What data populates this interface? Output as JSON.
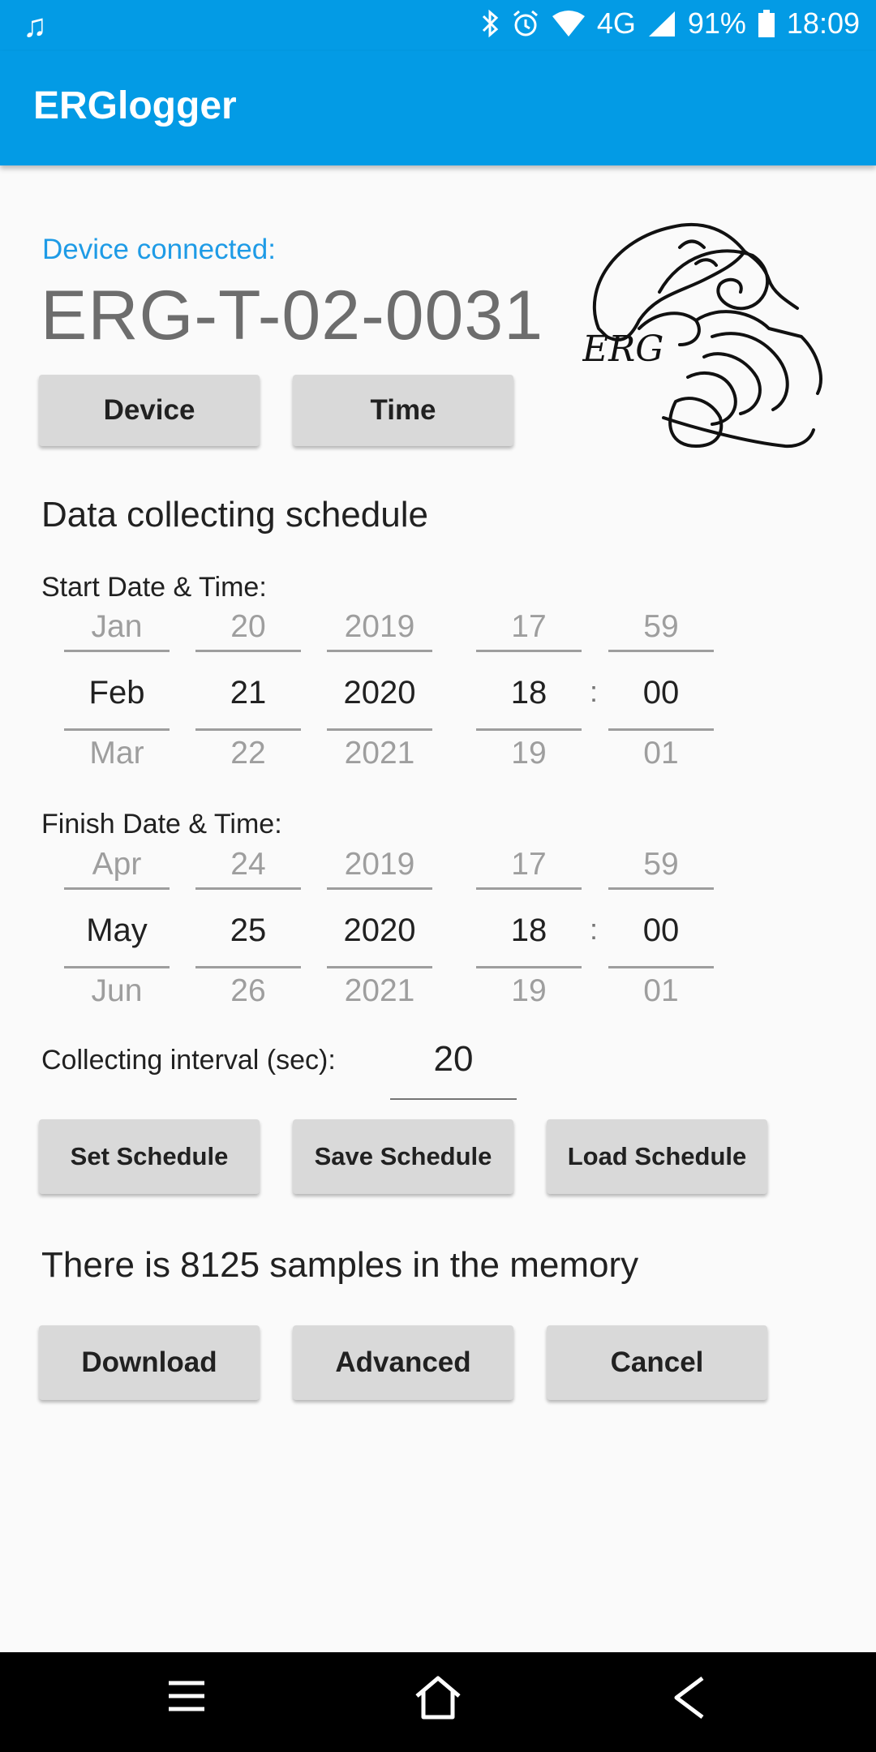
{
  "status_bar": {
    "battery": "91%",
    "time": "18:09",
    "network": "4G",
    "icons": [
      "music-note-icon",
      "bluetooth-icon",
      "alarm-icon",
      "wifi-icon",
      "signal-icon",
      "battery-icon"
    ]
  },
  "app": {
    "title": "ERGlogger",
    "accent_color": "#039be5"
  },
  "device": {
    "label": "Device connected:",
    "name": "ERG-T-02-0031"
  },
  "buttons": {
    "device": "Device",
    "time": "Time"
  },
  "logo": {
    "text": "ERG"
  },
  "schedule": {
    "title": "Data collecting schedule",
    "start_label": "Start Date & Time:",
    "finish_label": "Finish Date & Time:",
    "start": {
      "month": {
        "prev": "Jan",
        "cur": "Feb",
        "next": "Mar"
      },
      "day": {
        "prev": "20",
        "cur": "21",
        "next": "22"
      },
      "year": {
        "prev": "2019",
        "cur": "2020",
        "next": "2021"
      },
      "hour": {
        "prev": "17",
        "cur": "18",
        "next": "19"
      },
      "minute": {
        "prev": "59",
        "cur": "00",
        "next": "01"
      }
    },
    "finish": {
      "month": {
        "prev": "Apr",
        "cur": "May",
        "next": "Jun"
      },
      "day": {
        "prev": "24",
        "cur": "25",
        "next": "26"
      },
      "year": {
        "prev": "2019",
        "cur": "2020",
        "next": "2021"
      },
      "hour": {
        "prev": "17",
        "cur": "18",
        "next": "19"
      },
      "minute": {
        "prev": "59",
        "cur": "00",
        "next": "01"
      }
    },
    "colon": ":",
    "interval_label": "Collecting interval (sec):",
    "interval_value": "20"
  },
  "schedule_buttons": {
    "set": "Set Schedule",
    "save": "Save Schedule",
    "load": "Load Schedule"
  },
  "memory_text": "There is 8125 samples in the memory",
  "action_buttons": {
    "download": "Download",
    "advanced": "Advanced",
    "cancel": "Cancel"
  }
}
